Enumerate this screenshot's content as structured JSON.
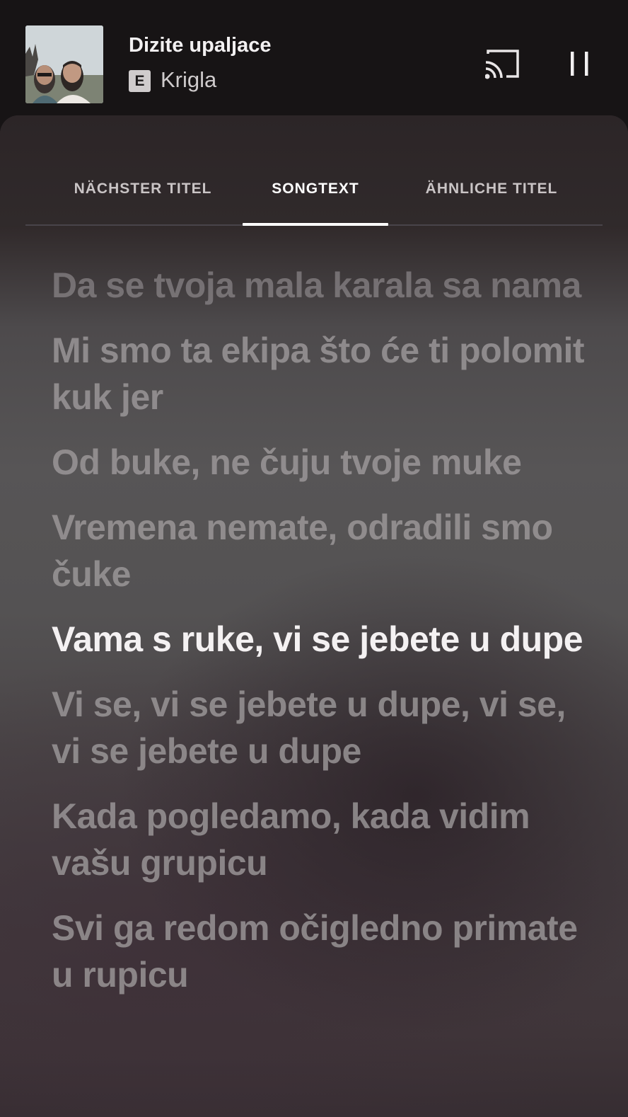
{
  "now_playing": {
    "title": "Dizite upaljace",
    "explicit_badge": "E",
    "artist": "Krigla",
    "icons": {
      "cast": "cast-icon",
      "pause": "pause-icon"
    }
  },
  "tabs": [
    {
      "label": "NÄCHSTER TITEL",
      "active": false
    },
    {
      "label": "SONGTEXT",
      "active": true
    },
    {
      "label": "ÄHNLICHE TITEL",
      "active": false
    }
  ],
  "lyrics": [
    {
      "text": "Da se tvoja mala karala sa nama",
      "current": false
    },
    {
      "text": "Mi smo ta ekipa što će ti polomit kuk jer",
      "current": false
    },
    {
      "text": "Od buke, ne čuju tvoje muke",
      "current": false
    },
    {
      "text": "Vremena nemate, odradili smo čuke",
      "current": false
    },
    {
      "text": "Vama s ruke, vi se jebete u dupe",
      "current": true
    },
    {
      "text": "Vi se, vi se jebete u dupe, vi se, vi se jebete u dupe",
      "current": false
    },
    {
      "text": "Kada pogledamo, kada vidim vašu grupicu",
      "current": false
    },
    {
      "text": "Svi ga redom očigledno primate u rupicu",
      "current": false
    }
  ],
  "colors": {
    "active_lyric": "#f4f1f2",
    "inactive_lyric": "#a09c9e",
    "tab_indicator": "#ffffff",
    "header_bg": "#171415"
  }
}
